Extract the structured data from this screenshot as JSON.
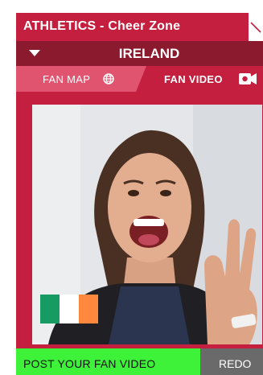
{
  "header": {
    "title": "ATHLETICS - Cheer Zone",
    "close_icon": "close-icon"
  },
  "country_selector": {
    "selected": "IRELAND",
    "caret_icon": "caret-down-icon"
  },
  "tabs": [
    {
      "label": "FAN MAP",
      "icon": "globe-icon",
      "active": false
    },
    {
      "label": "FAN VIDEO",
      "icon": "video-camera-icon",
      "active": true
    }
  ],
  "video": {
    "flag_colors": [
      "#169b62",
      "#ffffff",
      "#ff883e"
    ]
  },
  "actions": {
    "post_label": "POST YOUR FAN VIDEO",
    "redo_label": "REDO"
  },
  "colors": {
    "primary": "#c41f3e",
    "dark": "#8b1a2e",
    "tab_active": "#e05470",
    "post_button": "#3ef23a",
    "redo_button": "#6a6a6a"
  }
}
